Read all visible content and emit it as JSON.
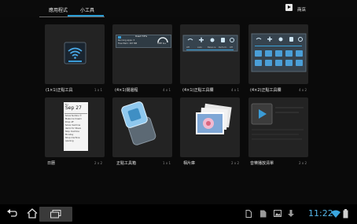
{
  "tabs": [
    {
      "label": "應用程式"
    },
    {
      "label": "小工具"
    }
  ],
  "shop": {
    "label": "商店",
    "icon": "play-store-icon"
  },
  "widgets": [
    {
      "title": "(1×1)正點工具",
      "size": "1 x 1"
    },
    {
      "title": "(4×1)揚邊程",
      "size": "4 x 1",
      "preview": {
        "header": "Used 74%",
        "line1": "Running apps: 3",
        "line2": "Free Mem: 167 MB",
        "gauge": "FREE   ALL"
      }
    },
    {
      "title": "(4×1)正點工具欄",
      "size": "4 x 1",
      "preview": {
        "labels": [
          "Off",
          "Auto",
          "Balance",
          "Perform.",
          "Off"
        ]
      }
    },
    {
      "title": "(4×2)正點工具欄",
      "size": "4 x 2"
    },
    {
      "title": "日曆",
      "size": "2 x 2",
      "preview": {
        "day": "Fri",
        "date": "Sep 27",
        "events": [
          "Solve Sudoku ©",
          "Make Ice Cream",
          "Drop off",
          "Solve machine demo for Steve",
          "Stop machine Monday",
          "Shop machine opening"
        ]
      }
    },
    {
      "title": "正點工具箱",
      "size": "1 x 1"
    },
    {
      "title": "相片庫",
      "size": "2 x 2"
    },
    {
      "title": "音樂播放清單",
      "size": "2 x 2"
    }
  ],
  "statusbar": {
    "time": "11:22"
  },
  "colors": {
    "accent": "#2a9ed6",
    "clock": "#56b7ea",
    "card": "#232323"
  }
}
